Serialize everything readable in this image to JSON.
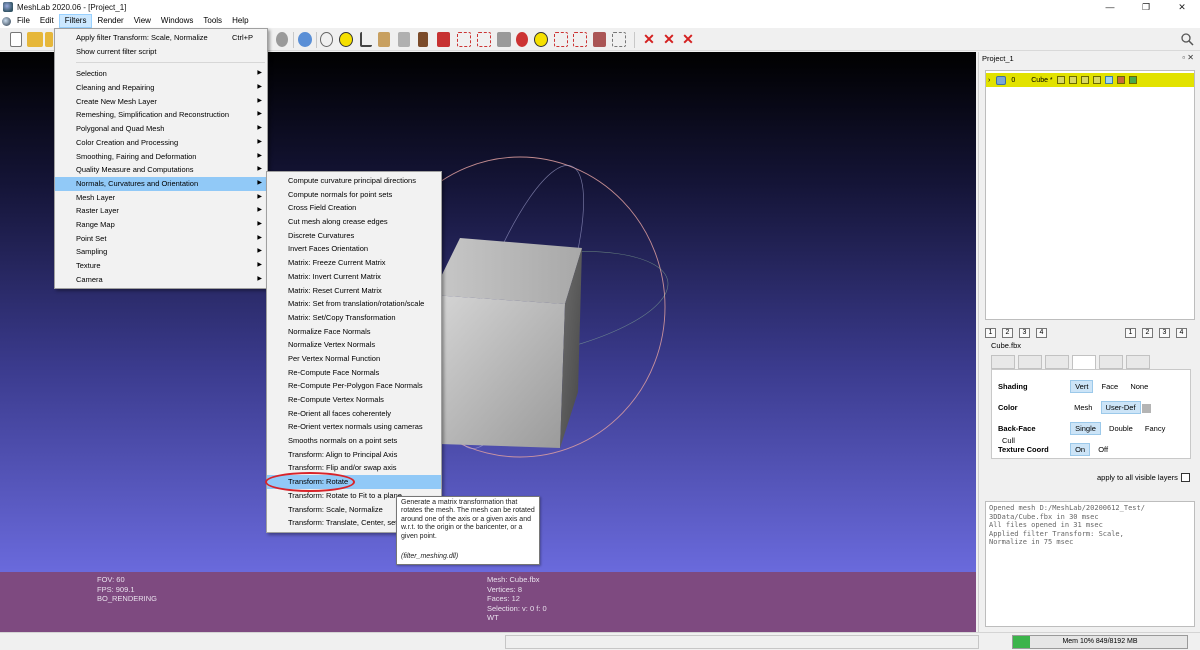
{
  "window": {
    "title": "MeshLab 2020.06 - [Project_1]",
    "controls": [
      "—",
      "❐",
      "✕"
    ]
  },
  "menubar": {
    "items": [
      "File",
      "Edit",
      "Filters",
      "Render",
      "View",
      "Windows",
      "Tools",
      "Help"
    ],
    "active": "Filters"
  },
  "filters_menu": {
    "top_items": [
      {
        "label": "Apply filter Transform: Scale, Normalize",
        "shortcut": "Ctrl+P"
      },
      {
        "label": "Show current filter script",
        "shortcut": ""
      }
    ],
    "items": [
      "Selection",
      "Cleaning and Repairing",
      "Create New Mesh Layer",
      "Remeshing, Simplification and Reconstruction",
      "Polygonal and Quad Mesh",
      "Color Creation and Processing",
      "Smoothing, Fairing and Deformation",
      "Quality Measure and Computations",
      "Normals, Curvatures and Orientation",
      "Mesh Layer",
      "Raster Layer",
      "Range Map",
      "Point Set",
      "Sampling",
      "Texture",
      "Camera"
    ],
    "highlighted": "Normals, Curvatures and Orientation"
  },
  "submenu": {
    "items": [
      "Compute curvature principal directions",
      "Compute normals for point sets",
      "Cross Field Creation",
      "Cut mesh along crease edges",
      "Discrete Curvatures",
      "Invert Faces Orientation",
      "Matrix: Freeze Current Matrix",
      "Matrix: Invert Current Matrix",
      "Matrix: Reset Current Matrix",
      "Matrix: Set from translation/rotation/scale",
      "Matrix: Set/Copy Transformation",
      "Normalize Face Normals",
      "Normalize Vertex Normals",
      "Per Vertex Normal Function",
      "Re-Compute Face Normals",
      "Re-Compute Per-Polygon Face Normals",
      "Re-Compute Vertex Normals",
      "Re-Orient all faces coherentely",
      "Re-Orient vertex normals using cameras",
      "Smooths normals on a point sets",
      "Transform: Align to Principal Axis",
      "Transform: Flip and/or swap axis",
      "Transform: Rotate",
      "Transform: Rotate to Fit to a plane",
      "Transform: Scale, Normalize",
      "Transform: Translate, Center, set Origin"
    ],
    "highlighted": "Transform: Rotate"
  },
  "tooltip": {
    "text": "Generate a matrix transformation that rotates the mesh. The mesh can be rotated around one of the axis or a given axis and w.r.t. to the origin or the baricenter, or a given point.",
    "dll": "(filter_meshing.dll)"
  },
  "viewport_info": {
    "left": [
      "FOV: 60",
      "FPS:  909.1",
      "BO_RENDERING"
    ],
    "right": [
      "Mesh: Cube.fbx",
      "Vertices: 8",
      "Faces: 12",
      "Selection: v: 0 f: 0",
      "WT"
    ]
  },
  "right_panel": {
    "title": "Project_1",
    "controls": "▫ ✕",
    "layer": {
      "index": "0",
      "name": "Cube *"
    },
    "num_buttons": [
      "1",
      "2",
      "3",
      "4"
    ],
    "mesh_name": "Cube.fbx",
    "props": {
      "shading": {
        "label": "Shading",
        "options": [
          "Vert",
          "Face",
          "None"
        ],
        "selected": "Vert"
      },
      "color": {
        "label": "Color",
        "options": [
          "Mesh",
          "User-Def"
        ],
        "selected": "User-Def"
      },
      "backface": {
        "label": "Back-Face",
        "options": [
          "Single",
          "Double",
          "Fancy",
          "Cull"
        ],
        "selected": "Single"
      },
      "texture": {
        "label": "Texture Coord",
        "options": [
          "On",
          "Off"
        ],
        "selected": "On"
      }
    },
    "apply_all": "apply to all visible layers",
    "log": [
      "Opened mesh D:/MeshLab/20200612_Test/",
      "3DData/Cube.fbx in 30 msec",
      "All files opened in 31 msec",
      "Applied filter Transform: Scale,",
      "Normalize in 75 msec"
    ]
  },
  "statusbar": {
    "memory": "Mem 10% 849/8192 MB",
    "memory_fraction": 0.1
  },
  "colors": {
    "menu_highlight": "#91c9f7",
    "layer_selected": "#e2e200",
    "info_bar": "#7e4a80",
    "annotation_ring": "#d8232a",
    "memory_fill": "#3cb44b"
  }
}
